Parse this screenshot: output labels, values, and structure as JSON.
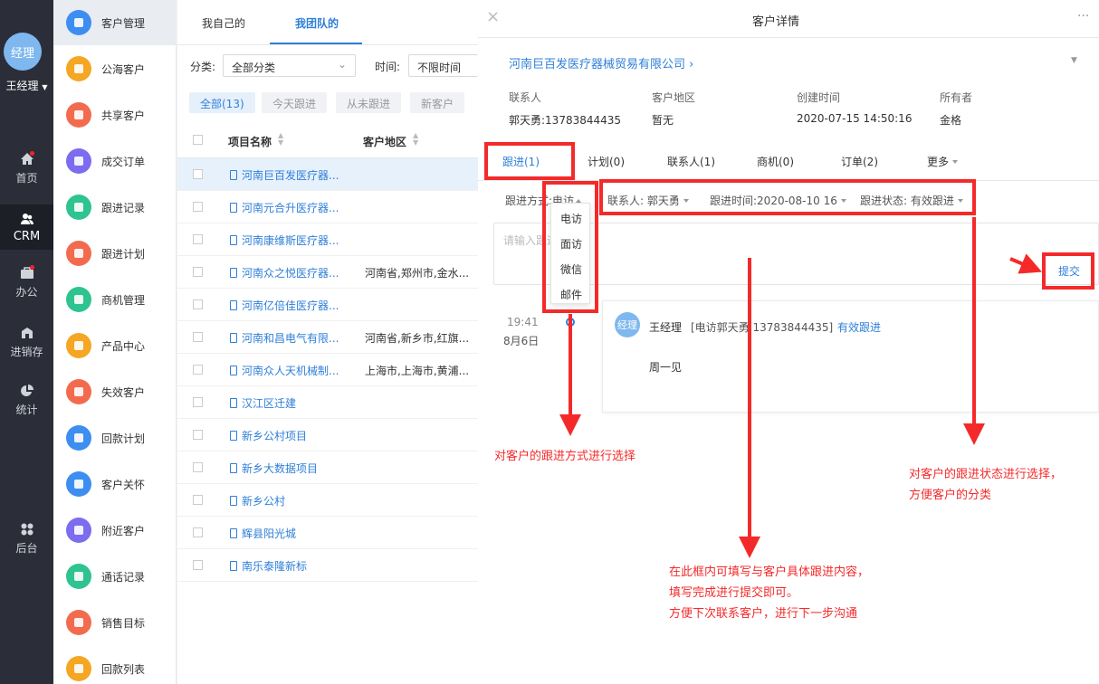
{
  "user": {
    "avatar_text": "经理",
    "name": "王经理"
  },
  "main_nav": [
    {
      "label": "首页",
      "icon": "home-icon"
    },
    {
      "label": "CRM",
      "icon": "people-icon"
    },
    {
      "label": "办公",
      "icon": "briefcase-icon"
    },
    {
      "label": "进销存",
      "icon": "warehouse-icon"
    },
    {
      "label": "统计",
      "icon": "pie-chart-icon"
    },
    {
      "label": "后台",
      "icon": "grid-icon"
    }
  ],
  "modules": [
    {
      "label": "客户管理",
      "color": "#3d8ef0"
    },
    {
      "label": "公海客户",
      "color": "#f5a623"
    },
    {
      "label": "共享客户",
      "color": "#f36b4f"
    },
    {
      "label": "成交订单",
      "color": "#7b6cf0"
    },
    {
      "label": "跟进记录",
      "color": "#2ec38f"
    },
    {
      "label": "跟进计划",
      "color": "#f36b4f"
    },
    {
      "label": "商机管理",
      "color": "#2ec38f"
    },
    {
      "label": "产品中心",
      "color": "#f5a623"
    },
    {
      "label": "失效客户",
      "color": "#f36b4f"
    },
    {
      "label": "回款计划",
      "color": "#3d8ef0"
    },
    {
      "label": "客户关怀",
      "color": "#3d8ef0"
    },
    {
      "label": "附近客户",
      "color": "#7b6cf0"
    },
    {
      "label": "通话记录",
      "color": "#2ec38f"
    },
    {
      "label": "销售目标",
      "color": "#f36b4f"
    },
    {
      "label": "回款列表",
      "color": "#f5a623"
    }
  ],
  "list": {
    "tabs": [
      "我自己的",
      "我团队的"
    ],
    "category_label": "分类:",
    "category_value": "全部分类",
    "time_label": "时间:",
    "time_value": "不限时间",
    "chips": [
      "全部(13)",
      "今天跟进",
      "从未跟进",
      "新客户"
    ],
    "col_project": "项目名称",
    "col_region": "客户地区",
    "rows": [
      {
        "name": "河南巨百发医疗器...",
        "region": ""
      },
      {
        "name": "河南元合升医疗器...",
        "region": ""
      },
      {
        "name": "河南康维斯医疗器...",
        "region": ""
      },
      {
        "name": "河南众之悦医疗器...",
        "region": "河南省,郑州市,金水..."
      },
      {
        "name": "河南亿倍佳医疗器...",
        "region": ""
      },
      {
        "name": "河南和昌电气有限...",
        "region": "河南省,新乡市,红旗..."
      },
      {
        "name": "河南众人天机械制...",
        "region": "上海市,上海市,黄浦..."
      },
      {
        "name": "汉江区迁建",
        "region": ""
      },
      {
        "name": "新乡公村项目",
        "region": ""
      },
      {
        "name": "新乡大数据项目",
        "region": ""
      },
      {
        "name": "新乡公村",
        "region": ""
      },
      {
        "name": "辉县阳光城",
        "region": ""
      },
      {
        "name": "南乐泰隆新标",
        "region": ""
      }
    ]
  },
  "detail": {
    "title": "客户详情",
    "more": "···",
    "company": "河南巨百发医疗器械贸易有限公司",
    "fields": [
      {
        "label": "联系人",
        "value": "郭天勇:13783844435"
      },
      {
        "label": "客户地区",
        "value": "暂无"
      },
      {
        "label": "创建时间",
        "value": "2020-07-15 14:50:16"
      },
      {
        "label": "所有者",
        "value": "金格"
      }
    ],
    "tabs": [
      "跟进(1)",
      "计划(0)",
      "联系人(1)",
      "商机(0)",
      "订单(2)",
      "更多"
    ],
    "followup": {
      "method_label": "跟进方式:",
      "method_value": "电访",
      "method_options": [
        "电访",
        "面访",
        "微信",
        "邮件"
      ],
      "contact": "联系人: 郭天勇",
      "time": "跟进时间:2020-08-10 16",
      "status": "跟进状态: 有效跟进",
      "placeholder": "请输入跟进",
      "submit": "提交"
    },
    "record": {
      "time": "19:41",
      "date": "8月6日",
      "avatar": "经理",
      "author": "王经理",
      "meta": "[电访郭天勇 13783844435]",
      "status": "有效跟进",
      "content": "周一见"
    }
  },
  "annotations": {
    "method": "对客户的跟进方式进行选择",
    "content": [
      "在此框内可填写与客户具体跟进内容，",
      "填写完成进行提交即可。",
      "方便下次联系客户，进行下一步沟通"
    ],
    "status": [
      "对客户的跟进状态进行选择，",
      "方便客户的分类"
    ]
  },
  "colors": {
    "accent": "#2f7fd8",
    "annotation": "#f42a2a",
    "nav_bg": "#2b2e38"
  }
}
